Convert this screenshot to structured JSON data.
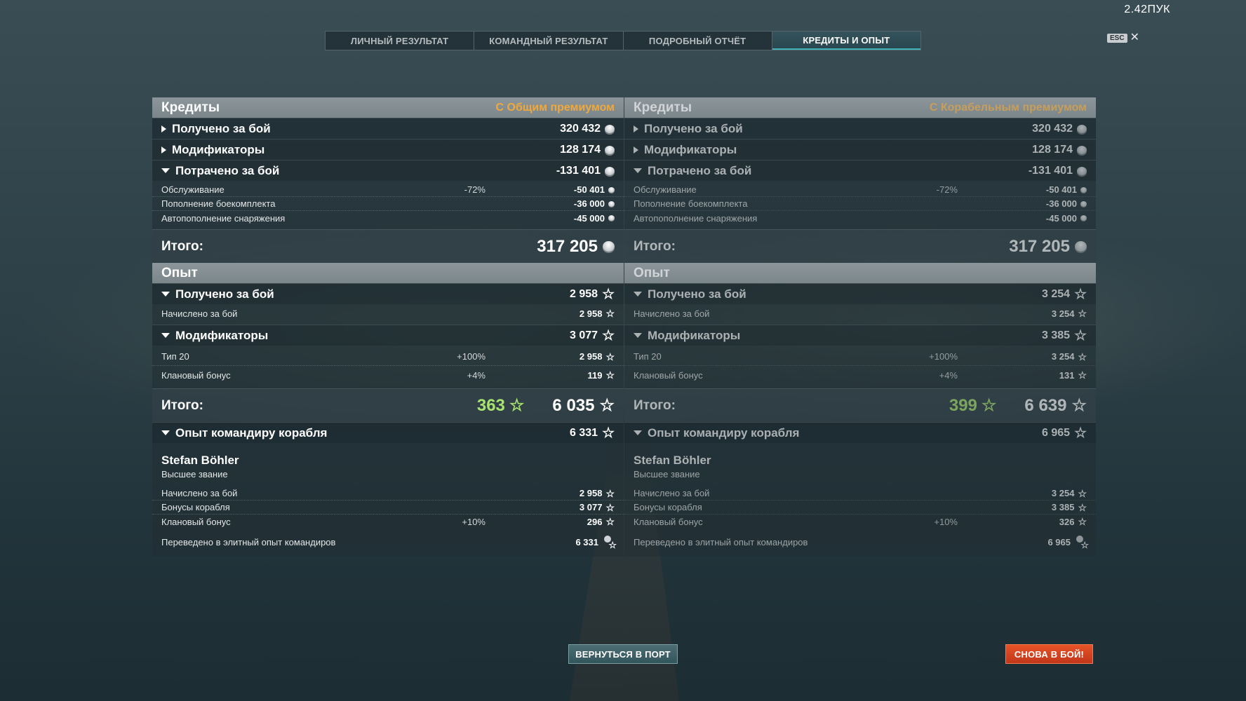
{
  "fps": "2.42ПУК",
  "esc": {
    "key": "ESC",
    "close": "✕"
  },
  "tabs": [
    "ЛИЧНЫЙ РЕЗУЛЬТАТ",
    "КОМАНДНЫЙ РЕЗУЛЬТАТ",
    "ПОДРОБНЫЙ ОТЧЁТ",
    "КРЕДИТЫ И ОПЫТ"
  ],
  "active_tab": 3,
  "panels": [
    {
      "premium": "С Общим премиумом",
      "credits": {
        "title": "Кредиты",
        "earned_label": "Получено за бой",
        "earned": "320 432",
        "modifiers_label": "Модификаторы",
        "modifiers": "128 174",
        "spent_label": "Потрачено за бой",
        "spent": "-131 401",
        "spent_items": [
          {
            "label": "Обслуживание",
            "pct": "-72%",
            "value": "-50 401"
          },
          {
            "label": "Пополнение боекомплекта",
            "pct": "",
            "value": "-36 000"
          },
          {
            "label": "Автопополнение снаряжения",
            "pct": "",
            "value": "-45 000"
          }
        ],
        "total_label": "Итого:",
        "total": "317 205"
      },
      "xp": {
        "title": "Опыт",
        "earned_label": "Получено за бой",
        "earned": "2 958",
        "earned_items": [
          {
            "label": "Начислено за бой",
            "pct": "",
            "value": "2 958"
          }
        ],
        "modifiers_label": "Модификаторы",
        "modifiers": "3 077",
        "modifier_items": [
          {
            "label": "Тип 20",
            "pct": "+100%",
            "value": "2 958"
          },
          {
            "label": "Клановый бонус",
            "pct": "+4%",
            "value": "119"
          }
        ],
        "total_label": "Итого:",
        "free_xp": "363",
        "total": "6 035"
      },
      "commander": {
        "label": "Опыт командиру корабля",
        "value": "6 331",
        "name": "Stefan Böhler",
        "rank": "Высшее звание",
        "items": [
          {
            "label": "Начислено за бой",
            "pct": "",
            "value": "2 958"
          },
          {
            "label": "Бонусы корабля",
            "pct": "",
            "value": "3 077"
          },
          {
            "label": "Клановый бонус",
            "pct": "+10%",
            "value": "296"
          }
        ],
        "elite_label": "Переведено в элитный опыт командиров",
        "elite_value": "6 331"
      }
    },
    {
      "premium": "С Корабельным премиумом",
      "credits": {
        "title": "Кредиты",
        "earned_label": "Получено за бой",
        "earned": "320 432",
        "modifiers_label": "Модификаторы",
        "modifiers": "128 174",
        "spent_label": "Потрачено за бой",
        "spent": "-131 401",
        "spent_items": [
          {
            "label": "Обслуживание",
            "pct": "-72%",
            "value": "-50 401"
          },
          {
            "label": "Пополнение боекомплекта",
            "pct": "",
            "value": "-36 000"
          },
          {
            "label": "Автопополнение снаряжения",
            "pct": "",
            "value": "-45 000"
          }
        ],
        "total_label": "Итого:",
        "total": "317 205"
      },
      "xp": {
        "title": "Опыт",
        "earned_label": "Получено за бой",
        "earned": "3 254",
        "earned_items": [
          {
            "label": "Начислено за бой",
            "pct": "",
            "value": "3 254"
          }
        ],
        "modifiers_label": "Модификаторы",
        "modifiers": "3 385",
        "modifier_items": [
          {
            "label": "Тип 20",
            "pct": "+100%",
            "value": "3 254"
          },
          {
            "label": "Клановый бонус",
            "pct": "+4%",
            "value": "131"
          }
        ],
        "total_label": "Итого:",
        "free_xp": "399",
        "total": "6 639"
      },
      "commander": {
        "label": "Опыт командиру корабля",
        "value": "6 965",
        "name": "Stefan Böhler",
        "rank": "Высшее звание",
        "items": [
          {
            "label": "Начислено за бой",
            "pct": "",
            "value": "3 254"
          },
          {
            "label": "Бонусы корабля",
            "pct": "",
            "value": "3 385"
          },
          {
            "label": "Клановый бонус",
            "pct": "+10%",
            "value": "326"
          }
        ],
        "elite_label": "Переведено в элитный опыт командиров",
        "elite_value": "6 965"
      }
    }
  ],
  "buttons": {
    "return_port": "ВЕРНУТЬСЯ В ПОРТ",
    "battle_again": "СНОВА В БОЙ!"
  },
  "colors": {
    "premium_accent": "#f0a83a",
    "free_xp": "#a9e36f",
    "battle_button": "#d94520",
    "active_tab_underline": "#3fb3b8"
  }
}
